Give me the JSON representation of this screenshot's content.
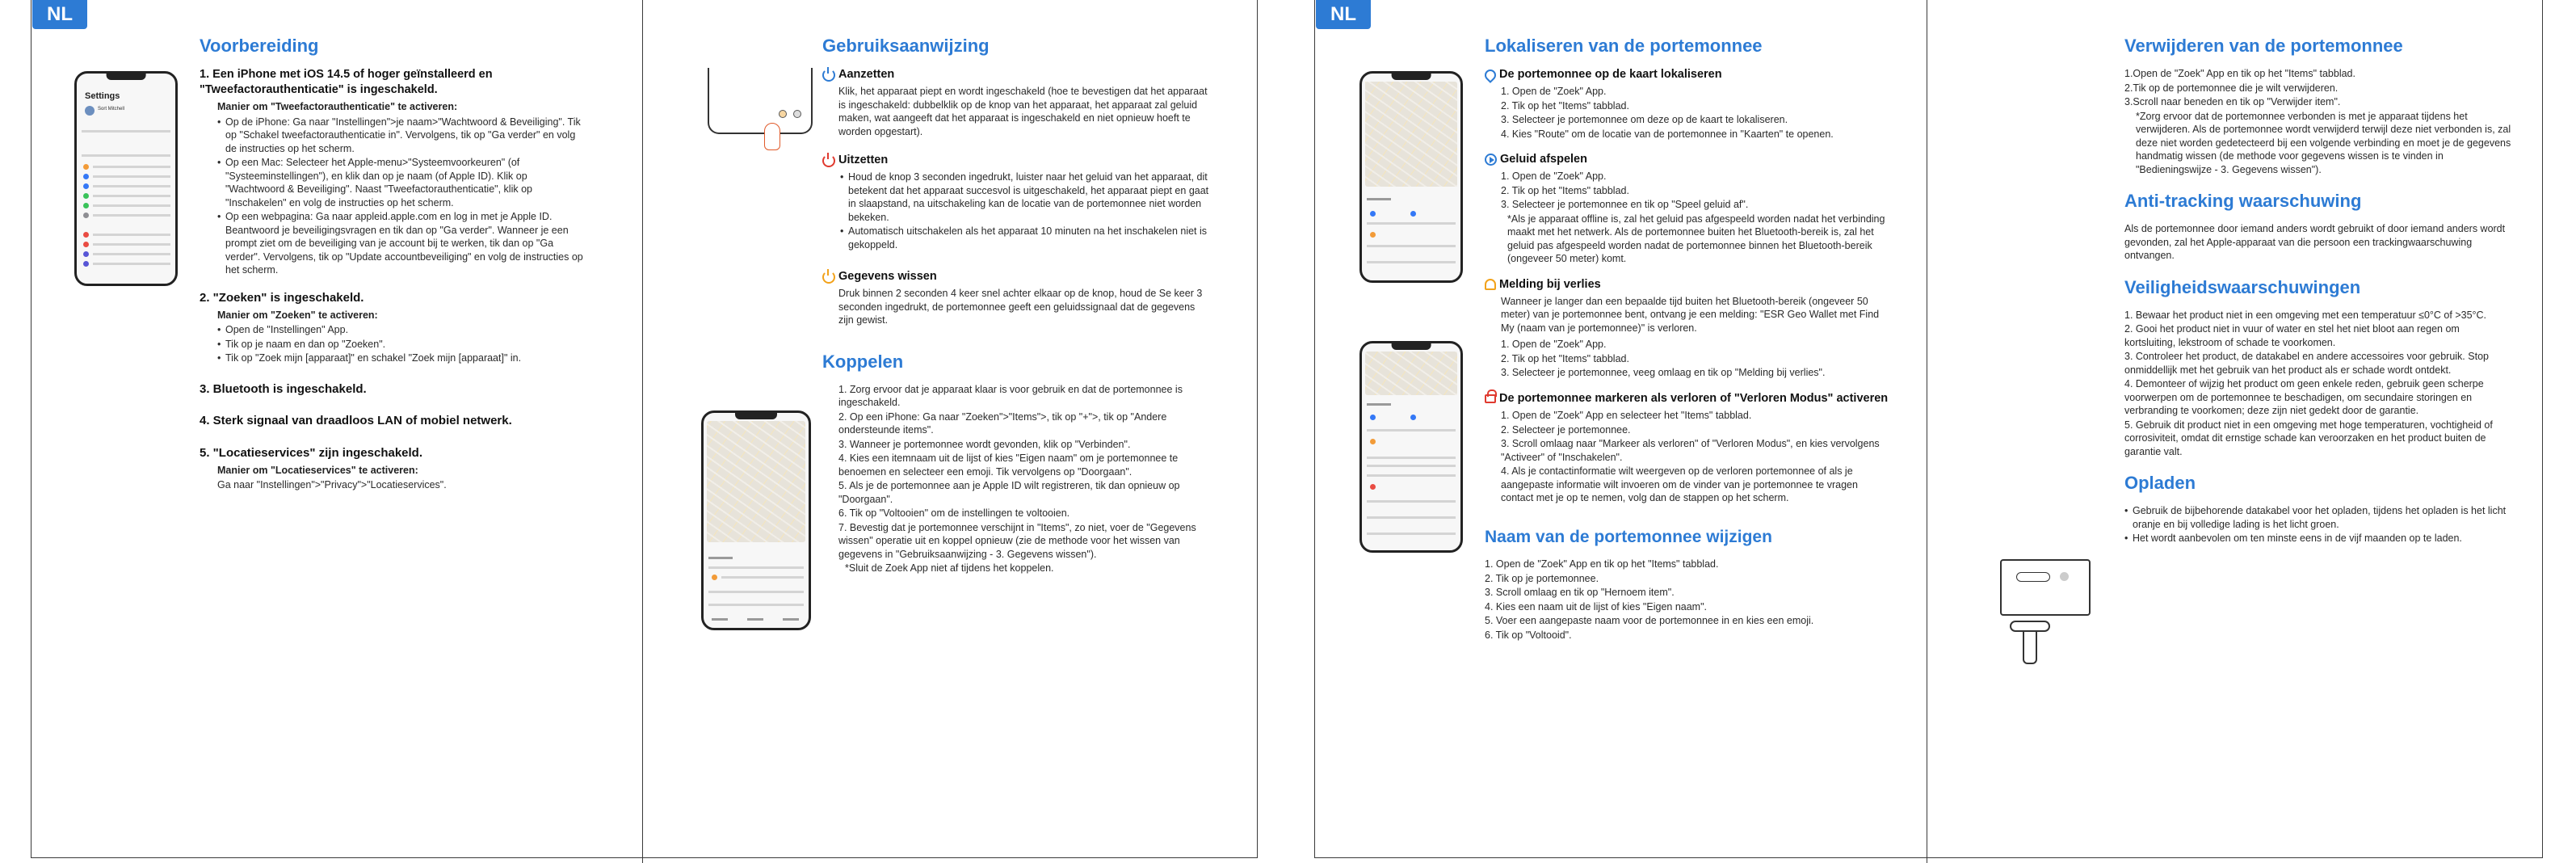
{
  "lang_badge": "NL",
  "p1": {
    "title": "Voorbereiding",
    "s1_title": "1. Een iPhone met iOS 14.5 of hoger geïnstalleerd en \"Tweefactorauthenticatie\" is ingeschakeld.",
    "s1_sub": "Manier om \"Tweefactorauthenticatie\" te activeren:",
    "s1_b1": "Op de iPhone: Ga naar \"Instellingen\">je naam>\"Wachtwoord & Beveiliging\". Tik op \"Schakel tweefactorauthenticatie in\". Vervolgens, tik op \"Ga verder\" en volg de instructies op het scherm.",
    "s1_b2": "Op een Mac: Selecteer het Apple-menu>\"Systeemvoorkeuren\" (of \"Systeeminstellingen\"), en klik dan op je naam (of Apple ID). Klik op \"Wachtwoord & Beveiliging\". Naast \"Tweefactorauthenticatie\", klik op \"Inschakelen\" en volg de instructies op het scherm.",
    "s1_b3": "Op een webpagina: Ga naar appleid.apple.com en log in met je Apple ID. Beantwoord je beveiligingsvragen en tik dan op \"Ga verder\". Wanneer je een prompt ziet om de beveiliging van je account bij te werken, tik dan op \"Ga verder\". Vervolgens, tik op \"Update accountbeveiliging\" en volg de instructies op het scherm.",
    "s2_title": "2. \"Zoeken\" is ingeschakeld.",
    "s2_sub": "Manier om \"Zoeken\" te activeren:",
    "s2_b1": "Open de \"Instellingen\" App.",
    "s2_b2": "Tik op je naam en dan op \"Zoeken\".",
    "s2_b3": "Tik op \"Zoek mijn [apparaat]\" en schakel \"Zoek mijn [apparaat]\" in.",
    "s3_title": "3. Bluetooth is ingeschakeld.",
    "s4_title": "4. Sterk signaal van draadloos LAN of mobiel netwerk.",
    "s5_title": "5. \"Locatieservices\" zijn ingeschakeld.",
    "s5_sub": "Manier om \"Locatieservices\" te activeren:",
    "s5_text": "Ga naar \"Instellingen\">\"Privacy\">\"Locatieservices\".",
    "phone_title": "Settings",
    "phone_user": "Sort Mitchell"
  },
  "p2": {
    "title": "Gebruiksaanwijzing",
    "on_title": "Aanzetten",
    "on_text": "Klik, het apparaat piept en wordt ingeschakeld (hoe te bevestigen dat het apparaat is ingeschakeld: dubbelklik op de knop van het apparaat, het apparaat zal geluid maken, wat aangeeft dat het apparaat is ingeschakeld en niet opnieuw hoeft te worden opgestart).",
    "off_title": "Uitzetten",
    "off_b1": "Houd de knop 3 seconden ingedrukt, luister naar het geluid van het apparaat, dit betekent dat het apparaat succesvol is uitgeschakeld, het apparaat piept en gaat in slaapstand, na uitschakeling kan de locatie van de portemonnee niet worden bekeken.",
    "off_b2": "Automatisch uitschakelen als het apparaat 10 minuten na het inschakelen niet is gekoppeld.",
    "wipe_title": "Gegevens wissen",
    "wipe_text": "Druk binnen 2 seconden 4 keer snel achter elkaar op de knop, houd de Se keer 3 seconden ingedrukt, de portemonnee geeft een geluidssignaal dat de gegevens zijn gewist.",
    "pair_title": "Koppelen",
    "pair_1": "1. Zorg ervoor dat je apparaat klaar is voor gebruik en dat de portemonnee is ingeschakeld.",
    "pair_2": "2. Op een iPhone: Ga naar \"Zoeken\">\"Items\">, tik op \"+\">, tik op \"Andere ondersteunde items\".",
    "pair_3": "3. Wanneer je portemonnee wordt gevonden, klik op \"Verbinden\".",
    "pair_4": "4. Kies een itemnaam uit de lijst of kies \"Eigen naam\" om je portemonnee te benoemen en selecteer een emoji. Tik vervolgens op \"Doorgaan\".",
    "pair_5": "5. Als je de portemonnee aan je Apple ID wilt registreren, tik dan opnieuw op \"Doorgaan\".",
    "pair_6": "6. Tik op \"Voltooien\" om de instellingen te voltooien.",
    "pair_7": "7. Bevestig dat je portemonnee verschijnt in \"Items\", zo niet, voer de \"Gegevens wissen\" operatie uit en koppel opnieuw (zie de methode voor het wissen van gegevens in \"Gebruiksaanwijzing - 3. Gegevens wissen\").",
    "pair_note": "*Sluit de Zoek App niet af tijdens het koppelen."
  },
  "p3": {
    "title": "Lokaliseren van de portemonnee",
    "map_title": "De portemonnee op de kaart lokaliseren",
    "map_1": "1. Open de \"Zoek\" App.",
    "map_2": "2. Tik op het \"Items\" tabblad.",
    "map_3": "3. Selecteer je portemonnee om deze op de kaart te lokaliseren.",
    "map_4": "4. Kies \"Route\" om de locatie van de portemonnee in \"Kaarten\" te openen.",
    "snd_title": "Geluid afspelen",
    "snd_1": "1. Open de \"Zoek\" App.",
    "snd_2": "2. Tik op het \"Items\" tabblad.",
    "snd_3": "3. Selecteer je portemonnee en tik op \"Speel geluid af\".",
    "snd_note": "*Als je apparaat offline is, zal het geluid pas afgespeeld worden nadat het verbinding maakt met het netwerk. Als de portemonnee buiten het Bluetooth-bereik is, zal het geluid pas afgespeeld worden nadat de portemonnee binnen het Bluetooth-bereik (ongeveer 50 meter) komt.",
    "loss_title": "Melding bij verlies",
    "loss_text": "Wanneer je langer dan een bepaalde tijd buiten het Bluetooth-bereik (ongeveer 50 meter) van je portemonnee bent, ontvang je een melding: \"ESR Geo Wallet met Find My (naam van je portemonnee)\" is verloren.",
    "loss_1": "1. Open de \"Zoek\" App.",
    "loss_2": "2. Tik op het \"Items\" tabblad.",
    "loss_3": "3. Selecteer je portemonnee, veeg omlaag en tik op \"Melding bij verlies\".",
    "lost_title": "De portemonnee markeren als verloren of \"Verloren Modus\" activeren",
    "lost_1": "1. Open de \"Zoek\" App en selecteer het \"Items\" tabblad.",
    "lost_2": "2. Selecteer je portemonnee.",
    "lost_3": "3. Scroll omlaag naar \"Markeer als verloren\" of \"Verloren Modus\", en kies vervolgens \"Activeer\" of \"Inschakelen\".",
    "lost_4": "4. Als je contactinformatie wilt weergeven op de verloren portemonnee of als je aangepaste informatie wilt invoeren om de vinder van je portemonnee te vragen contact met je op te nemen, volg dan de stappen op het scherm.",
    "rename_title": "Naam van de portemonnee wijzigen",
    "rename_1": "1. Open de \"Zoek\" App en tik op het \"Items\" tabblad.",
    "rename_2": "2. Tik op je portemonnee.",
    "rename_3": "3. Scroll omlaag en tik op \"Hernoem item\".",
    "rename_4": "4. Kies een naam uit de lijst of kies \"Eigen naam\".",
    "rename_5": "5. Voer een aangepaste naam voor de portemonnee in en kies een emoji.",
    "rename_6": "6. Tik op \"Voltooid\"."
  },
  "p4": {
    "title": "Verwijderen van de portemonnee",
    "rm_1": "1.Open de \"Zoek\" App en tik op het \"Items\" tabblad.",
    "rm_2": "2.Tik op de portemonnee die je wilt verwijderen.",
    "rm_3": "3.Scroll naar beneden en tik op \"Verwijder item\".",
    "rm_note": "*Zorg ervoor dat de portemonnee verbonden is met je apparaat tijdens het verwijderen. Als de portemonnee wordt verwijderd terwijl deze niet verbonden is, zal deze niet worden gedetecteerd bij een volgende verbinding en moet je de gegevens handmatig wissen (de methode voor gegevens wissen is te vinden in \"Bedieningswijze - 3. Gegevens wissen\").",
    "at_title": "Anti-tracking waarschuwing",
    "at_text": "Als de portemonnee door iemand anders wordt gebruikt of door iemand anders wordt gevonden, zal het Apple-apparaat van die persoon een trackingwaarschuwing ontvangen.",
    "safety_title": "Veiligheidswaarschuwingen",
    "safety_1": "1. Bewaar het product niet in een omgeving met een temperatuur ≤0°C of >35°C.",
    "safety_2": "2. Gooi het product niet in vuur of water en stel het niet bloot aan regen om kortsluiting, lekstroom of schade te voorkomen.",
    "safety_3": "3. Controleer het product, de datakabel en andere accessoires voor gebruik. Stop onmiddellijk met het gebruik van het product als er schade wordt ontdekt.",
    "safety_4": "4. Demonteer of wijzig het product om geen enkele reden, gebruik geen scherpe voorwerpen om de portemonnee te beschadigen, om secundaire storingen en verbranding te voorkomen; deze zijn niet gedekt door de garantie.",
    "safety_5": "5. Gebruik dit product niet in een omgeving met hoge temperaturen, vochtigheid of corrosiviteit, omdat dit ernstige schade kan veroorzaken en het product buiten de garantie valt.",
    "charge_title": "Opladen",
    "charge_b1": "Gebruik de bijbehorende datakabel voor het opladen, tijdens het opladen is het licht oranje en bij volledige lading is het licht groen.",
    "charge_b2": "Het wordt aanbevolen om ten minste eens in de vijf maanden op te laden."
  }
}
